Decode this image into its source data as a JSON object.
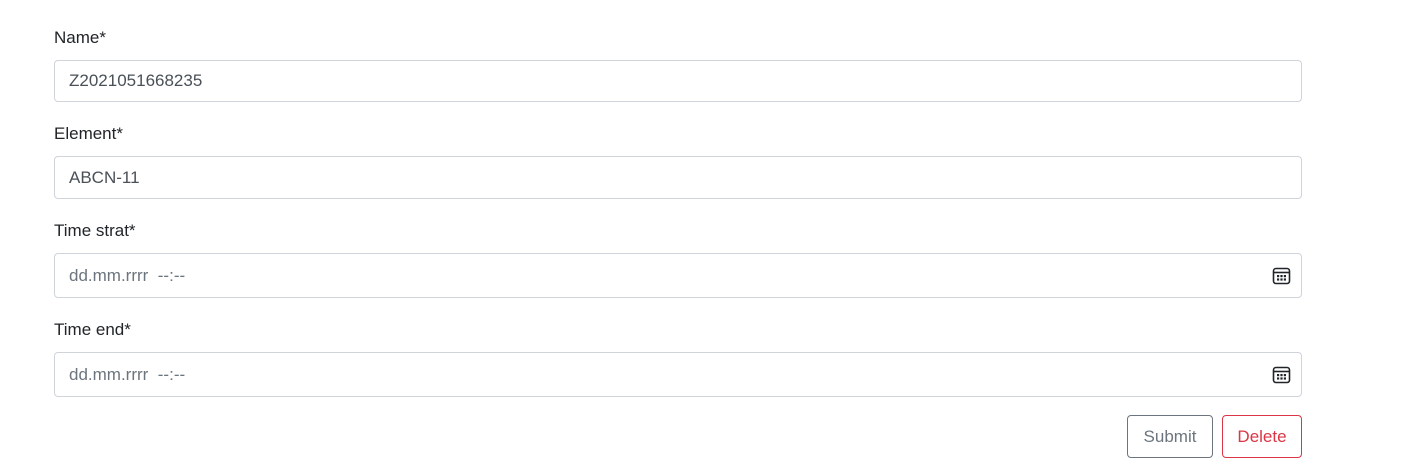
{
  "form": {
    "name": {
      "label": "Name*",
      "value": "Z2021051668235"
    },
    "element": {
      "label": "Element*",
      "value": "ABCN-11"
    },
    "time_start": {
      "label": "Time strat*",
      "placeholder": "dd.mm.rrrr  --:--",
      "icon": "calendar-icon"
    },
    "time_end": {
      "label": "Time end*",
      "placeholder": "dd.mm.rrrr  --:--",
      "icon": "calendar-icon"
    }
  },
  "actions": {
    "submit_label": "Submit",
    "delete_label": "Delete"
  },
  "colors": {
    "submit": "#6c757d",
    "delete": "#dc3545",
    "border": "#ced4da"
  }
}
